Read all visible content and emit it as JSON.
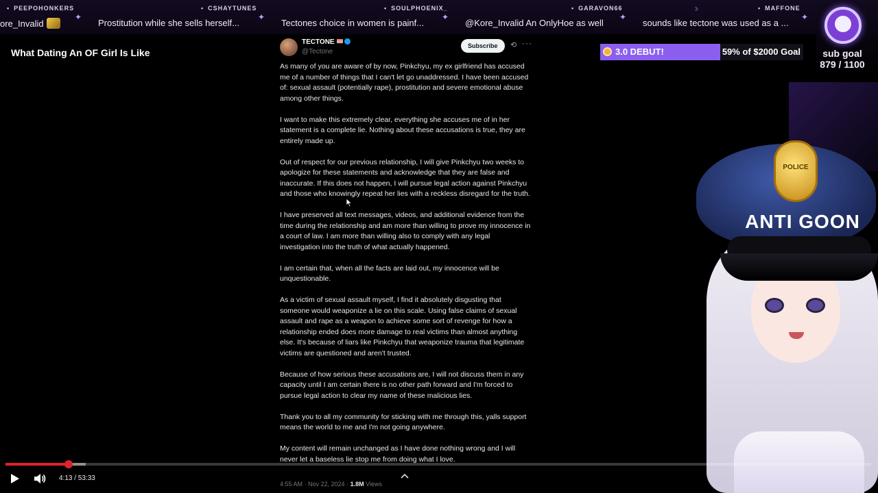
{
  "ticker": {
    "items": [
      {
        "user": "PEEPOHONKERS",
        "message": "ore_Invalid"
      },
      {
        "user": "CSHAYTUNES",
        "message": "Prostitution while she sells herself..."
      },
      {
        "user": "SOULPHOENIX_",
        "message": "Tectones choice in women is painf..."
      },
      {
        "user": "GARAVON66",
        "message": "@Kore_Invalid An OnlyHoe as well"
      },
      {
        "user": "MAFFONE",
        "message": "sounds like tectone was used as a ..."
      }
    ]
  },
  "subgoal": {
    "label": "sub goal",
    "count": "879 / 1100",
    "current": 879,
    "target": 1100,
    "accent": "#8d5bff"
  },
  "video": {
    "title": "What Dating An OF Girl Is Like"
  },
  "tweet": {
    "display_name": "TECTONE",
    "handle": "@Tectone",
    "subscribe_label": "Subscribe",
    "paragraphs": [
      "As many of you are aware of by now, Pinkchyu, my ex girlfriend has accused me of a number of things that I can't let go unaddressed. I have been accused of: sexual assault (potentially rape), prostitution and severe emotional abuse among other things.",
      "I want to make this extremely clear, everything she accuses me of in her statement is a complete lie. Nothing about these accusations is true, they are entirely made up.",
      "Out of respect for our previous relationship, I will give Pinkchyu two weeks to apologize for these statements and acknowledge that they are false and inaccurate. If this does not happen, I will pursue legal action against Pinkchyu and those who knowingly repeat her lies with a reckless disregard for the truth.",
      "I have preserved all text messages, videos, and additional evidence from the time during the relationship and am more than willing to prove my innocence in a court of law. I am more than willing also to comply with any legal investigation into the truth of what actually happened.",
      "I am certain that, when all the facts are laid out, my innocence will be unquestionable.",
      "As a victim of sexual assault myself, I find it absolutely disgusting that someone would weaponize a lie on this scale. Using false claims of sexual assault and rape as a weapon to achieve some sort of revenge for how a relationship ended does more damage to real victims than almost anything else. It's because of liars like Pinkchyu that weaponize trauma that legitimate victims are questioned and aren't trusted.",
      "Because of how serious these accusations are, I will not discuss them in any capacity until I am certain there is no other path forward and I'm forced to pursue legal action to clear my name of these malicious lies.",
      "Thank you to all my community for sticking with me through this, yalls support means the world to me and I'm not going anywhere.",
      "My content will remain unchanged as I have done nothing wrong and I will never let a baseless lie stop me from doing what I love."
    ],
    "timestamp": "4:55 AM · Nov 22, 2024 ·",
    "views_count": "1.8M",
    "views_label": "Views"
  },
  "donation": {
    "label": "3.0 DEBUT!",
    "progress_text": "59% of $2000 Goal",
    "percent": 59,
    "color": "#8a5ff0"
  },
  "overlay": {
    "cap_text": "ANTI GOON",
    "badge_text": "POLICE"
  },
  "player": {
    "timecode": "4:13 / 53:33",
    "played_fraction": 0.0732,
    "buffered_fraction": 0.0927,
    "accent": "#e0222a"
  }
}
